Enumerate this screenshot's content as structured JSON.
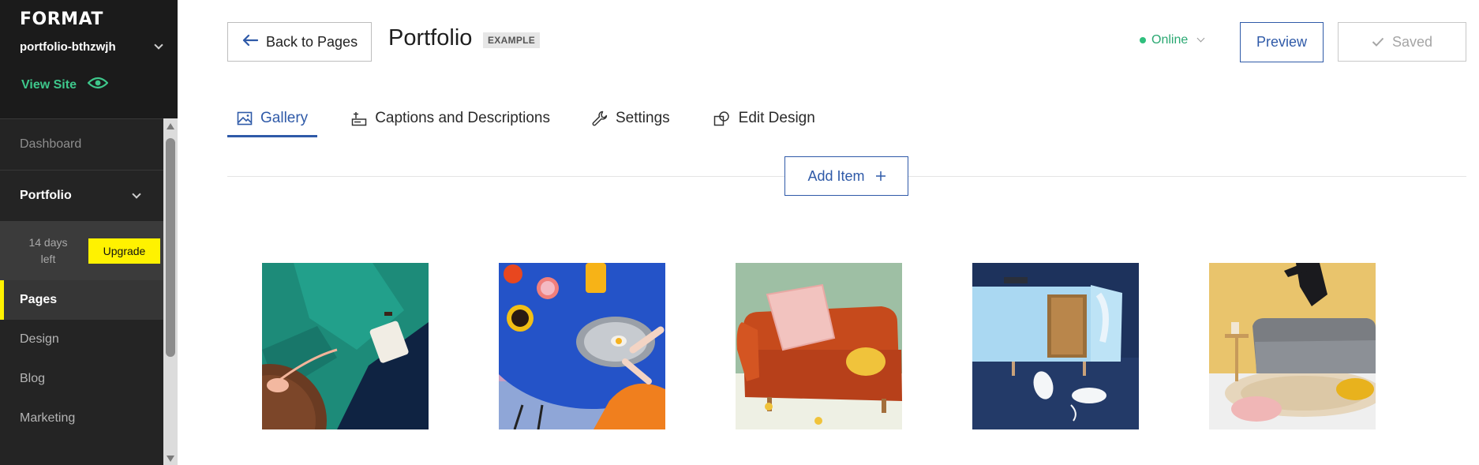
{
  "sidebar": {
    "logo": "FORMAT",
    "site_name": "portfolio-bthzwjh",
    "view_site": "View Site",
    "nav": {
      "dashboard": "Dashboard",
      "portfolio": "Portfolio",
      "trial_text": "14 days left",
      "upgrade": "Upgrade",
      "items": [
        {
          "label": "Pages"
        },
        {
          "label": "Design"
        },
        {
          "label": "Blog"
        },
        {
          "label": "Marketing"
        }
      ]
    }
  },
  "header": {
    "back_label": "Back to Pages",
    "title": "Portfolio",
    "badge": "EXAMPLE",
    "status": "Online",
    "preview": "Preview",
    "saved": "Saved"
  },
  "tabs": [
    {
      "label": "Gallery",
      "icon": "image-icon",
      "active": true
    },
    {
      "label": "Captions and Descriptions",
      "icon": "captions-icon"
    },
    {
      "label": "Settings",
      "icon": "wrench-icon"
    },
    {
      "label": "Edit Design",
      "icon": "design-shapes-icon"
    }
  ],
  "add_item": "Add Item",
  "gallery": [
    {
      "subject": "teal sofa with pink phone"
    },
    {
      "subject": "blue table breakfast"
    },
    {
      "subject": "orange sofa with pink pillow"
    },
    {
      "subject": "light blue cabinet with sneakers"
    },
    {
      "subject": "grey sofa with jumping person"
    }
  ],
  "colors": {
    "accent": "#2f5aa8",
    "online": "#2fbf7d",
    "upgrade": "#fff200",
    "view_site": "#3ec78b"
  }
}
